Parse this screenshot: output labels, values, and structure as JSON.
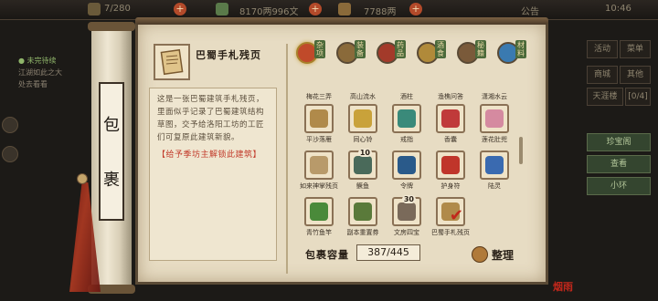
{
  "hud": {
    "res1": "7/280",
    "res2": "8170两996文",
    "res3": "7788两",
    "notice": "公告",
    "time": "10:46"
  },
  "quest": {
    "title": "● 未完待续",
    "line1": "江湖如此之大",
    "line2": "处去看看"
  },
  "right_panel": {
    "b1": "活动",
    "b2": "菜单",
    "b3": "商城",
    "b4": "其他",
    "b5": "天涯楼",
    "b6": "[0/4]",
    "b7": "珍宝阁",
    "b8": "查看",
    "b9": "小环"
  },
  "bag_title": [
    "包",
    "裹"
  ],
  "detail": {
    "name": "巴蜀手札残页",
    "description": "这是一张巴蜀建筑手札残页，里面似乎记录了巴蜀建筑结构草图，交予给洛阳工坊的工匠们可复原此建筑新貌。",
    "unlock": "【给予季坊主解锁此建筑】"
  },
  "tabs": [
    {
      "label": "杂项",
      "icon": "misc-icon",
      "color": "#c04a2a",
      "active": true
    },
    {
      "label": "装备",
      "icon": "equipment-icon",
      "color": "#8a6a3a",
      "active": false
    },
    {
      "label": "药品",
      "icon": "medicine-icon",
      "color": "#a33a2a",
      "active": false
    },
    {
      "label": "酒食",
      "icon": "food-icon",
      "color": "#b08a3a",
      "active": false
    },
    {
      "label": "秘籍",
      "icon": "manual-icon",
      "color": "#7a5a3a",
      "active": false
    },
    {
      "label": "材料",
      "icon": "material-icon",
      "color": "#3a7ab0",
      "active": false
    }
  ],
  "top_row_labels": [
    "梅花三弄",
    "高山流水",
    "酒柱",
    "渔樵问答",
    "潇湘水云"
  ],
  "items": [
    {
      "label": "平沙落雁",
      "icon": "scroll-book-icon",
      "color": "#b08a4a",
      "badge": "",
      "selected": false
    },
    {
      "label": "同心铃",
      "icon": "bell-icon",
      "color": "#c9a23a",
      "badge": "",
      "selected": false
    },
    {
      "label": "戒指",
      "icon": "ring-icon",
      "color": "#3a8a7a",
      "badge": "",
      "selected": false
    },
    {
      "label": "香囊",
      "icon": "sachet-icon",
      "color": "#c03a3a",
      "badge": "",
      "selected": false
    },
    {
      "label": "莲花肚兜",
      "icon": "bib-icon",
      "color": "#d58aa0",
      "badge": "",
      "selected": false
    },
    {
      "label": "如来神掌残页",
      "icon": "torn-page-icon",
      "color": "#b89a6a",
      "badge": "",
      "selected": false
    },
    {
      "label": "鳜鱼",
      "icon": "fish-icon",
      "color": "#4a6a5a",
      "badge": "10",
      "selected": false
    },
    {
      "label": "令牌",
      "icon": "token-icon",
      "color": "#2a5a8a",
      "badge": "",
      "selected": false
    },
    {
      "label": "护身符",
      "icon": "amulet-icon",
      "color": "#c0352a",
      "badge": "",
      "selected": false
    },
    {
      "label": "陆灵",
      "icon": "crossed-blades-icon",
      "color": "#3a6ab0",
      "badge": "",
      "selected": false
    },
    {
      "label": "青竹鱼竿",
      "icon": "fishing-rod-icon",
      "color": "#4a8a3a",
      "badge": "",
      "selected": false
    },
    {
      "label": "副本重置券",
      "icon": "ticket-icon",
      "color": "#5a7a3a",
      "badge": "",
      "selected": false
    },
    {
      "label": "文房四宝",
      "icon": "brush-set-icon",
      "color": "#7a6a5a",
      "badge": "30",
      "selected": false
    },
    {
      "label": "巴蜀手札残页",
      "icon": "note-page-icon",
      "color": "#b08a4a",
      "badge": "",
      "selected": true
    }
  ],
  "capacity": {
    "label": "包裹容量",
    "value": "387/445"
  },
  "sort_label": "整理",
  "seal_text": "烟雨"
}
